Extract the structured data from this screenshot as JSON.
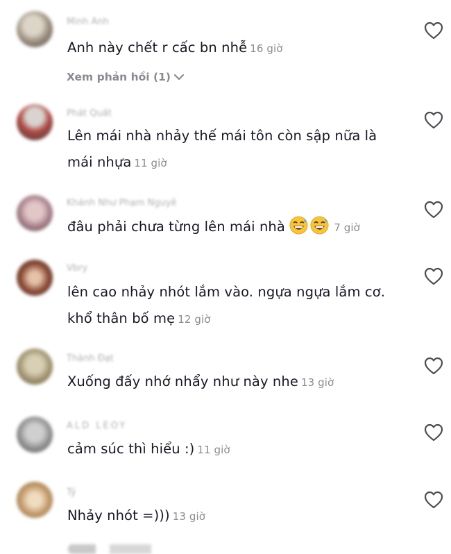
{
  "comments": [
    {
      "username": "Minh Anh",
      "text": "Anh này chết r cấc bn nhễ",
      "time": "16 giờ",
      "avatar_color": "#b9b3a6"
    },
    {
      "username": "Phát Quất",
      "text": "Lên mái nhà nhảy thế mái tôn còn sập nữa là mái nhựa",
      "time": "11 giờ",
      "avatar_color": "#9a4a4a"
    },
    {
      "username": "Khánh Như Phạm Nguyễ",
      "text": "đâu phải chưa từng lên mái nhà",
      "time": "7 giờ",
      "avatar_color": "#b48a90",
      "emojis": [
        "grinning-sweat-emoji",
        "grinning-sweat-emoji"
      ]
    },
    {
      "username": "Vbry",
      "text": "lên cao nhảy nhót lắm vào. ngựa ngựa lắm cơ. khổ thân bố mẹ",
      "time": "12 giờ",
      "avatar_color": "#7a4a3a"
    },
    {
      "username": "Thành Đạt",
      "text": "Xuống đấy nhớ nhẩy như này nhe",
      "time": "13 giờ",
      "avatar_color": "#a69a7a"
    },
    {
      "username": "ALD LEOY",
      "text": "cảm súc thì hiểu :)",
      "time": "11 giờ",
      "avatar_color": "#8b8b8b"
    },
    {
      "username": "Tý",
      "text": "Nhảy nhót =)))",
      "time": "13 giờ",
      "avatar_color": "#c7a57a"
    }
  ],
  "view_replies_label": "Xem phản hồi (1)",
  "icons": {
    "like": "heart-outline-icon",
    "expand": "chevron-down-icon"
  },
  "colors": {
    "text": "#161823",
    "secondary": "#8a8b91",
    "background": "#ffffff"
  }
}
